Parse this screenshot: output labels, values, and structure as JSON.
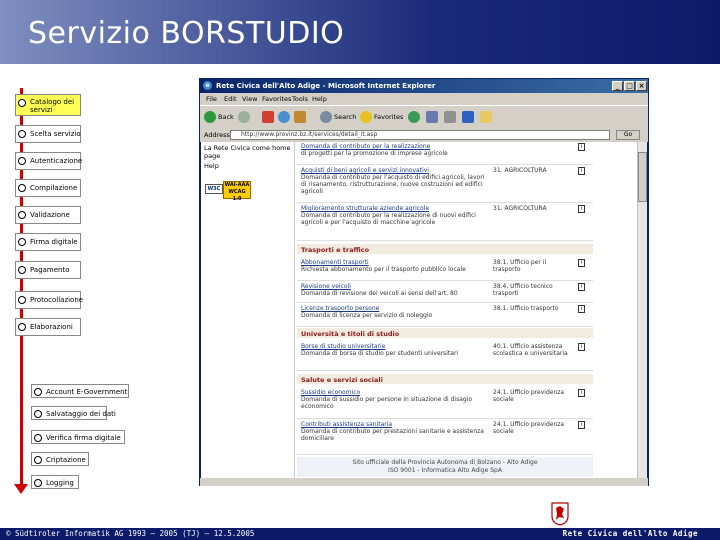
{
  "page": {
    "title": "Servizio BORSTUDIO"
  },
  "steps": [
    {
      "label": "Catalogo dei servizi",
      "active": true
    },
    {
      "label": "Scelta servizio"
    },
    {
      "label": "Autenticazione"
    },
    {
      "label": "Compilazione"
    },
    {
      "label": "Validazione"
    },
    {
      "label": "Firma digitale"
    },
    {
      "label": "Pagamento"
    },
    {
      "label": "Protocollazione"
    },
    {
      "label": "Elaborazioni"
    }
  ],
  "substeps": [
    {
      "label": "Account E-Government"
    },
    {
      "label": "Salvataggio dei dati"
    },
    {
      "label": "Verifica firma digitale"
    },
    {
      "label": "Criptazione"
    },
    {
      "label": "Logging"
    }
  ],
  "browser": {
    "title": "Rete Civica dell'Alto Adige - Microsoft Internet Explorer",
    "menu": [
      "File",
      "Edit",
      "View",
      "Favorites",
      "Tools",
      "Help"
    ],
    "toolbar": {
      "back": "Back",
      "search": "Search",
      "favorites": "Favorites"
    },
    "address_label": "Address",
    "address_value": "http://www.provinz.bz.it/services/detail_it.asp",
    "go": "Go",
    "left_links": [
      "La Rete Civica come home",
      "page",
      "Help"
    ],
    "badge_w3c": "W3C",
    "badge_wai": "WAI-AAA WCAG 1.0",
    "sections": [
      {
        "title": "Trasporti e traffico"
      },
      {
        "title": "Università e titoli di studio"
      },
      {
        "title": "Salute e servizi sociali"
      }
    ],
    "rows": [
      {
        "title": "Domanda di contributo per la realizzazione",
        "desc": "di progetti per la promozione di imprese agricole",
        "category": "",
        "icon": "i"
      },
      {
        "title": "Acquisti di beni agricoli e servizi innovativi",
        "desc": "Domanda di contributo per l'acquisto di edifici agricoli, lavori di risanamento, ristrutturazione, nuove costruzioni ed edifici agricoli",
        "category": "31. AGRICOLTURA",
        "icon": "i"
      },
      {
        "title": "Miglioramento strutturale aziende agricole",
        "desc": "Domanda di contributo per la realizzazione di nuovi edifici agricoli e per l'acquisto di macchine agricole",
        "category": "31. AGRICOLTURA",
        "icon": "i"
      },
      {
        "title": "Abbonamenti trasporti",
        "desc": "Richiesta abbonamento per il trasporto pubblico locale",
        "category": "38.1. Ufficio per il trasporto",
        "icon": "i"
      },
      {
        "title": "Revisione veicoli",
        "desc": "Domanda di revisione dei veicoli ai sensi dell'art. 80",
        "category": "38.4. Ufficio tecnico trasporti",
        "icon": "i"
      },
      {
        "title": "Licenze trasporto persone",
        "desc": "Domanda di licenza per servizio di noleggio",
        "category": "38.1. Ufficio trasporto",
        "icon": "i"
      },
      {
        "title": "Borse di studio universitarie",
        "desc": "Domanda di borsa di studio per studenti universitari",
        "category": "40.1. Ufficio assistenza scolastica e universitaria",
        "icon": "i"
      },
      {
        "title": "Sussidio economico",
        "desc": "Domanda di sussidio per persone in situazione di disagio economico",
        "category": "24.1. Ufficio previdenza sociale",
        "icon": "i"
      },
      {
        "title": "Contributi assistenza sanitaria",
        "desc": "Domanda di contributo per prestazioni sanitarie e assistenza domiciliare",
        "category": "24.1. Ufficio previdenza sociale",
        "icon": "i"
      }
    ],
    "footer_line1": "Sito ufficiale della Provincia Autonoma di Bolzano - Alto Adige",
    "footer_line2": "ISO 9001 - Informatica Alto Adige SpA"
  },
  "footer": {
    "copyright": "© Südtiroler Informatik AG 1993 – 2005 (TJ) – 12.5.2005",
    "brand": "Rete Civica dell'Alto Adige"
  },
  "colors": {
    "header": "#0c1a6a",
    "accent_arrow": "#d00000",
    "active_step": "#ffff55"
  }
}
